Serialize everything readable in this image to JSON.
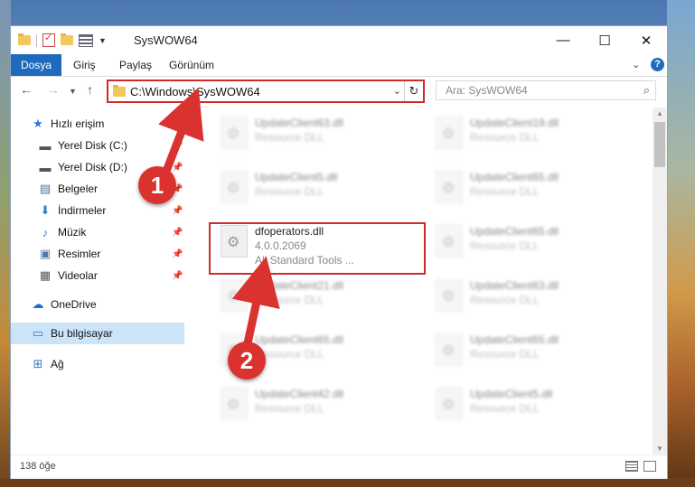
{
  "window": {
    "title": "SysWOW64",
    "controls": {
      "minimize": "—",
      "maximize": "☐",
      "close": "✕"
    }
  },
  "ribbon": {
    "tabs": [
      {
        "label": "Dosya",
        "active": true
      },
      {
        "label": "Giriş"
      },
      {
        "label": "Paylaş"
      },
      {
        "label": "Görünüm"
      }
    ],
    "help": "?"
  },
  "address": {
    "path": "C:\\Windows\\SysWOW64",
    "search_placeholder": "Ara: SysWOW64"
  },
  "nav": {
    "quick_access": "Hızlı erişim",
    "items": [
      {
        "label": "Yerel Disk (C:)",
        "icon": "drive-icon"
      },
      {
        "label": "Yerel Disk (D:)",
        "icon": "drive-icon"
      },
      {
        "label": "Belgeler",
        "icon": "documents-icon"
      },
      {
        "label": "İndirmeler",
        "icon": "download-icon"
      },
      {
        "label": "Müzik",
        "icon": "music-icon"
      },
      {
        "label": "Resimler",
        "icon": "pictures-icon"
      },
      {
        "label": "Videolar",
        "icon": "videos-icon"
      }
    ],
    "onedrive": "OneDrive",
    "this_pc": "Bu bilgisayar",
    "network": "Ağ"
  },
  "files": {
    "highlighted": {
      "name": "dfoperators.dll",
      "version": "4.0.0.2069",
      "company": "All Standard Tools ..."
    },
    "left_column": [
      {
        "name": "UpdateClient63.dll",
        "type": "Resource DLL"
      },
      {
        "name": "UpdateClient5.dll",
        "type": "Resource DLL"
      },
      {
        "name": "UpdateClient21.dll",
        "type": "Resource DLL"
      },
      {
        "name": "UpdateClient65.dll",
        "type": "Resource DLL"
      },
      {
        "name": "UpdateClient42.dll",
        "type": "Resource DLL"
      }
    ],
    "right_column": [
      {
        "name": "UpdateClient19.dll",
        "type": "Resource DLL"
      },
      {
        "name": "UpdateClient65.dll",
        "type": "Resource DLL"
      },
      {
        "name": "UpdateClient65.dll",
        "type": "Resource DLL"
      },
      {
        "name": "UpdateClient63.dll",
        "type": "Resource DLL"
      },
      {
        "name": "UpdateClient65.dll",
        "type": "Resource DLL"
      },
      {
        "name": "UpdateClient5.dll",
        "type": "Resource DLL"
      }
    ]
  },
  "status": {
    "item_count": "138 öğe"
  },
  "annotations": {
    "step1": "1",
    "step2": "2",
    "color": "#d9322f"
  }
}
